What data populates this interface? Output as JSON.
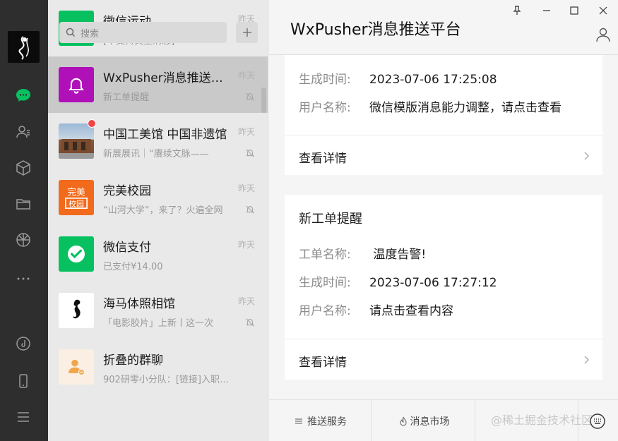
{
  "search": {
    "placeholder": "搜索"
  },
  "chats": [
    {
      "name": "微信运动",
      "time": "昨天",
      "preview": "[不支持类型消息]",
      "muted": false
    },
    {
      "name": "WxPusher消息推送平台",
      "time": "昨天",
      "preview": "新工单提醒",
      "muted": true
    },
    {
      "name": "中国工美馆 中国非遗馆",
      "time": "昨天",
      "preview": "新展展讯｜“赓续文脉——",
      "muted": true
    },
    {
      "name": "完美校园",
      "time": "昨天",
      "preview": "“山河大学”，来了？火遍全网",
      "muted": true
    },
    {
      "name": "微信支付",
      "time": "昨天",
      "preview": "已支付¥14.00",
      "muted": false
    },
    {
      "name": "海马体照相馆",
      "time": "昨天",
      "preview": "「电影胶片」上新丨这一次",
      "muted": true
    },
    {
      "name": "折叠的群聊",
      "time": "",
      "preview": "902研零小分队：[链接]入职…",
      "muted": false
    }
  ],
  "header": {
    "title": "WxPusher消息推送平台"
  },
  "card1": {
    "rows": [
      {
        "label": "生成时间:",
        "value": "2023-07-06 17:25:08"
      },
      {
        "label": "用户名称:",
        "value": "微信模版消息能力调整，请点击查看"
      }
    ],
    "detail": "查看详情"
  },
  "card2": {
    "heading": "新工单提醒",
    "rows": [
      {
        "label": "工单名称:",
        "value": " 温度告警!"
      },
      {
        "label": "生成时间:",
        "value": "2023-07-06 17:27:12"
      },
      {
        "label": "用户名称:",
        "value": "请点击查看内容"
      }
    ],
    "detail": "查看详情"
  },
  "bottom": {
    "tabs": [
      {
        "label": "推送服务",
        "icon": "menu-icon"
      },
      {
        "label": "消息市场",
        "icon": "flame-icon"
      },
      {
        "label": "",
        "icon": ""
      }
    ],
    "watermark": "@稀土掘金技术社区"
  },
  "colors": {
    "wechat_green": "#07c160",
    "rail": "#2e2e2e",
    "unread": "#f04545"
  }
}
